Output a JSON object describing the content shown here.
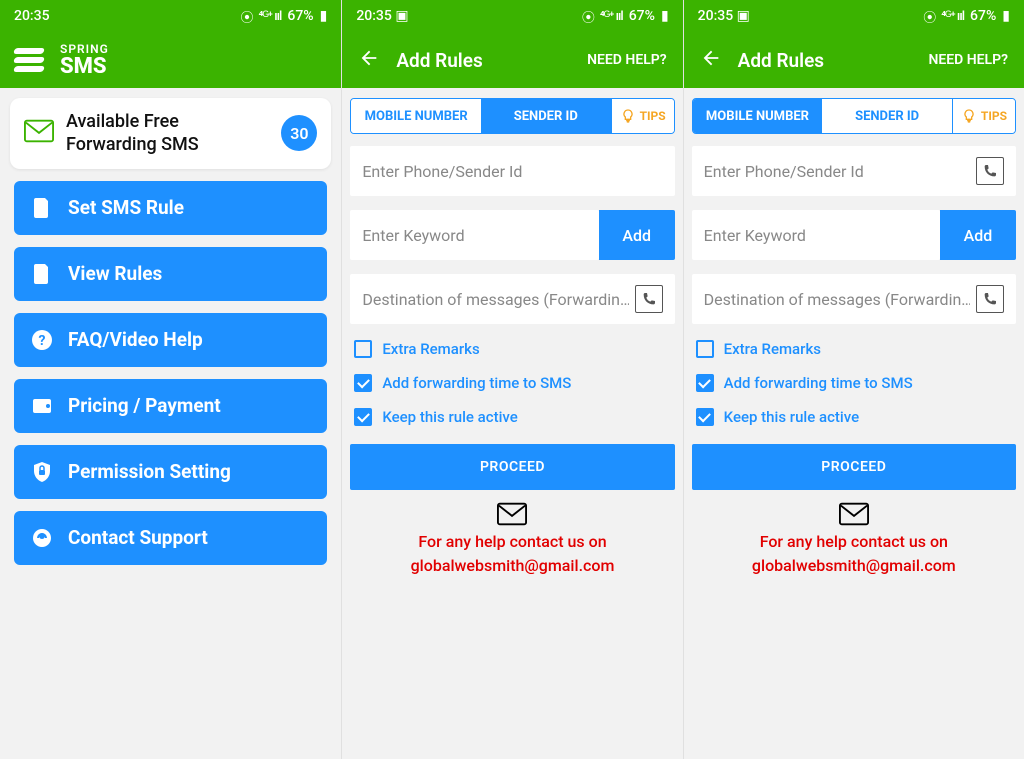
{
  "status": {
    "time": "20:35",
    "battery": "67%",
    "icons": "⦿ ⁴ᴳ ᵤₗₗ"
  },
  "brand": {
    "line1": "SPRING",
    "line2": "SMS"
  },
  "free": {
    "label": "Available Free Forwarding SMS",
    "count": "30"
  },
  "menu": [
    {
      "label": "Set SMS Rule"
    },
    {
      "label": "View Rules"
    },
    {
      "label": "FAQ/Video Help"
    },
    {
      "label": "Pricing / Payment"
    },
    {
      "label": "Permission Setting"
    },
    {
      "label": "Contact Support"
    }
  ],
  "rules": {
    "title": "Add Rules",
    "help": "NEED HELP?",
    "tabs": {
      "mobile": "MOBILE NUMBER",
      "sender": "SENDER ID",
      "tips": "TIPS"
    },
    "ph_sender": "Enter Phone/Sender Id",
    "ph_keyword": "Enter Keyword",
    "add": "Add",
    "ph_dest": "Destination of messages (Forwardin…",
    "chk_extra": "Extra Remarks",
    "chk_time": "Add forwarding time to SMS",
    "chk_active": "Keep this rule active",
    "proceed": "PROCEED",
    "contact1": "For any help contact us on",
    "contact2": "globalwebsmith@gmail.com"
  }
}
